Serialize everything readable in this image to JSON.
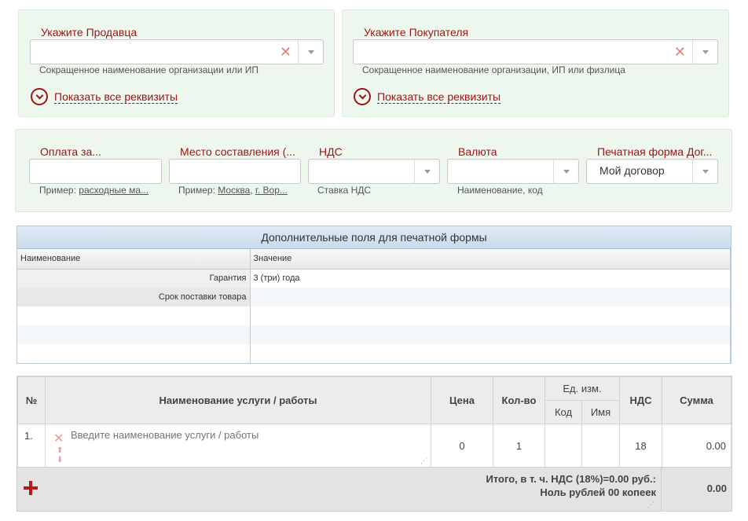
{
  "seller": {
    "label": "Укажите Продавца",
    "value": "",
    "hint": "Сокращенное наименование организации или ИП",
    "details_link": "Показать все реквизиты"
  },
  "buyer": {
    "label": "Укажите Покупателя",
    "value": "",
    "hint": "Сокращенное наименование организации, ИП или физлица",
    "details_link": "Показать все реквизиты"
  },
  "params": {
    "payment": {
      "label": "Оплата за...",
      "value": "",
      "hint_prefix": "Пример:",
      "hint_link": "расходные ма..."
    },
    "place": {
      "label": "Место составления (...",
      "value": "",
      "hint_prefix": "Пример:",
      "hint_link1": "Москва",
      "hint_sep": ",",
      "hint_link2": "г. Вор..."
    },
    "vat": {
      "label": "НДС",
      "value": "",
      "hint": "Ставка НДС"
    },
    "currency": {
      "label": "Валюта",
      "value": "",
      "hint": "Наименование, код"
    },
    "print_form": {
      "label": "Печатная форма Дог...",
      "value": "Мой договор"
    }
  },
  "extra_fields": {
    "title": "Дополнительные поля для печатной формы",
    "col_name": "Наименование",
    "col_value": "Значение",
    "rows": [
      {
        "name": "Гарантия",
        "value": "3 (три) года"
      },
      {
        "name": "Срок поставки товара",
        "value": ""
      },
      {
        "name": "",
        "value": ""
      },
      {
        "name": "",
        "value": ""
      },
      {
        "name": "",
        "value": ""
      }
    ]
  },
  "services": {
    "headers": {
      "num": "№",
      "name": "Наименование услуги / работы",
      "price": "Цена",
      "qty": "Кол-во",
      "unit": "Ед. изм.",
      "unit_code": "Код",
      "unit_name": "Имя",
      "vat": "НДС",
      "sum": "Сумма"
    },
    "rows": [
      {
        "num": "1.",
        "name_placeholder": "Введите наименование услуги / работы",
        "price": "0",
        "qty": "1",
        "unit_code": "",
        "unit_name": "",
        "vat": "18",
        "sum": "0.00"
      }
    ],
    "total_line1": "Итого, в т. ч. НДС (18%)=0.00 руб.:",
    "total_line2": "Ноль рублей 00 копеек",
    "total_sum": "0.00"
  },
  "colors": {
    "accent": "#a01414",
    "panel_bg": "#eef7ee",
    "header_blue": "#c9dbec"
  },
  "icons": [
    "clear-icon",
    "chevron-down-icon",
    "expand-circle-icon",
    "move-up-icon",
    "move-down-icon",
    "resize-grip-icon",
    "add-icon"
  ]
}
